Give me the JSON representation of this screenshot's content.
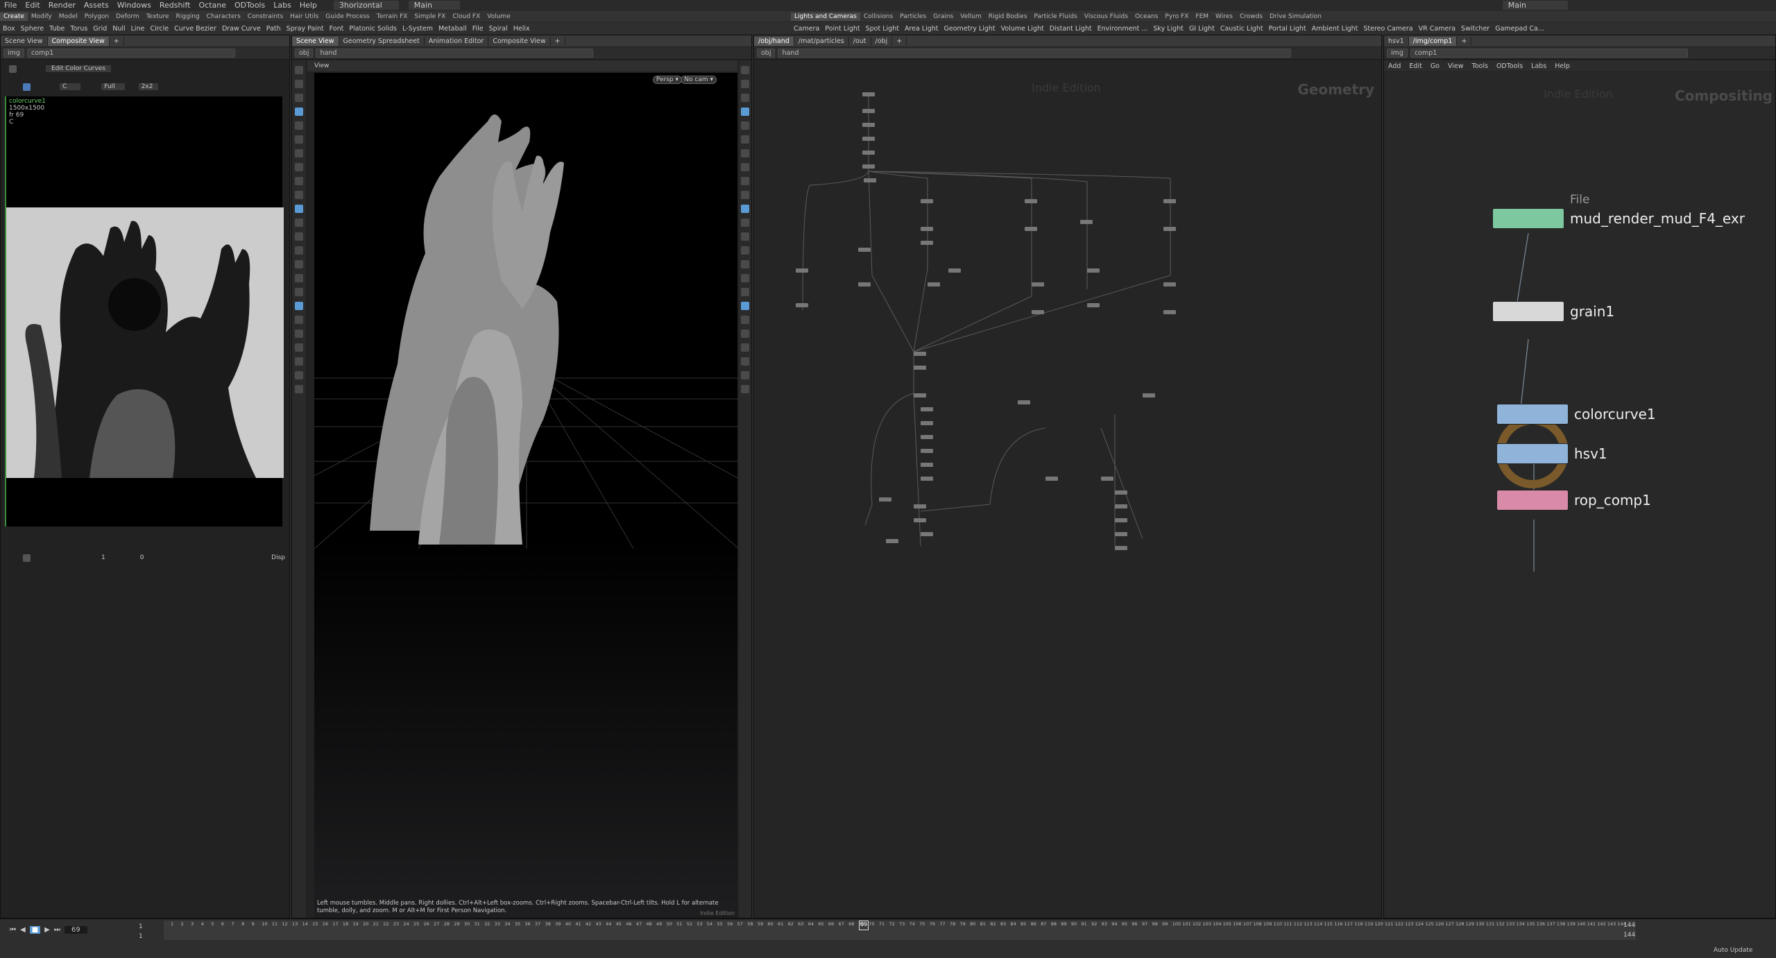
{
  "menu": {
    "items": [
      "File",
      "Edit",
      "Render",
      "Assets",
      "Windows",
      "Redshift",
      "Octane",
      "ODTools",
      "Labs",
      "Help"
    ],
    "desktop": "3horizontal",
    "context": "Main",
    "right_context": "Main"
  },
  "shelf_left": {
    "tabs": [
      "Create",
      "Modify",
      "Model",
      "Polygon",
      "Deform",
      "Texture",
      "Rigging",
      "Characters",
      "Constraints",
      "Hair Utils",
      "Guide Process",
      "Terrain FX",
      "Simple FX",
      "Cloud FX",
      "Volume"
    ],
    "tools": [
      "Box",
      "Sphere",
      "Tube",
      "Torus",
      "Grid",
      "Null",
      "Line",
      "Circle",
      "Curve Bezier",
      "Draw Curve",
      "Path",
      "Spray Paint",
      "Font",
      "Platonic Solids",
      "L-System",
      "Metaball",
      "File",
      "Spiral",
      "Helix"
    ]
  },
  "shelf_right": {
    "tabs": [
      "Lights and Cameras",
      "Collisions",
      "Particles",
      "Grains",
      "Vellum",
      "Rigid Bodies",
      "Particle Fluids",
      "Viscous Fluids",
      "Oceans",
      "Pyro FX",
      "FEM",
      "Wires",
      "Crowds",
      "Drive Simulation"
    ],
    "tools": [
      "Camera",
      "Point Light",
      "Spot Light",
      "Area Light",
      "Geometry Light",
      "Volume Light",
      "Distant Light",
      "Environment ...",
      "Sky Light",
      "GI Light",
      "Caustic Light",
      "Portal Light",
      "Ambient Light",
      "Stereo Camera",
      "VR Camera",
      "Switcher",
      "Gamepad Ca..."
    ]
  },
  "pane1": {
    "tabs": [
      "Scene View",
      "Composite View"
    ],
    "path": [
      "img",
      "comp1"
    ],
    "edit_button": "Edit Color Curves",
    "channel": "C",
    "res": "Full",
    "layout": "2x2",
    "info": [
      "colorcurve1",
      "1500x1500",
      "fr 69",
      "C"
    ],
    "bottom_frame": "1",
    "bottom_val": "0",
    "disp": "Disp"
  },
  "pane2": {
    "tabs": [
      "Scene View",
      "Geometry Spreadsheet",
      "Animation Editor",
      "Composite View"
    ],
    "path": [
      "obj",
      "hand"
    ],
    "view_label": "View",
    "persp": "Persp ▾",
    "cam": "No cam ▾",
    "hint": "Left mouse tumbles. Middle pans. Right dollies. Ctrl+Alt+Left box-zooms. Ctrl+Right zooms. Spacebar-Ctrl-Left tilts. Hold L for alternate tumble, dolly, and zoom.    M or Alt+M for First Person Navigation.",
    "edition": "Indie Edition"
  },
  "pane3": {
    "tabs": [
      "/obj/hand",
      "/mat/particles",
      "/out",
      "/obj"
    ],
    "path": [
      "obj",
      "hand"
    ],
    "watermark": "Indie Edition",
    "context": "Geometry"
  },
  "pane4": {
    "tabs": [
      "hsv1",
      "/img/comp1"
    ],
    "path": [
      "img",
      "comp1"
    ],
    "menu": [
      "Add",
      "Edit",
      "Go",
      "View",
      "Tools",
      "ODTools",
      "Labs",
      "Help"
    ],
    "watermark": "Indie Edition",
    "context": "Compositing",
    "nodes": [
      {
        "label": "mud_render_mud_F4_exr",
        "type": "File",
        "color": "#7ec8a0"
      },
      {
        "label": "grain1",
        "color": "#d8d8d8"
      },
      {
        "label": "colorcurve1",
        "color": "#8fb3d9"
      },
      {
        "label": "hsv1",
        "color": "#8fb3d9"
      },
      {
        "label": "rop_comp1",
        "color": "#d98aa8"
      }
    ]
  },
  "timeline": {
    "frame": "69",
    "start": "1",
    "start2": "1",
    "end": "144",
    "end2": "144",
    "ticks": [
      "1",
      "2",
      "3",
      "4",
      "5",
      "6",
      "7",
      "8",
      "9",
      "10",
      "11",
      "12",
      "13",
      "14",
      "15",
      "16",
      "17",
      "18",
      "19",
      "20",
      "21",
      "22",
      "23",
      "24",
      "25",
      "26",
      "27",
      "28",
      "29",
      "30",
      "31",
      "32",
      "33",
      "34",
      "35",
      "36",
      "37",
      "38",
      "39",
      "40",
      "41",
      "42",
      "43",
      "44",
      "45",
      "46",
      "47",
      "48",
      "49",
      "50",
      "51",
      "52",
      "53",
      "54",
      "55",
      "56",
      "57",
      "58",
      "59",
      "60",
      "61",
      "62",
      "63",
      "64",
      "65",
      "66",
      "67",
      "68",
      "69",
      "70",
      "71",
      "72",
      "73",
      "74",
      "75",
      "76",
      "77",
      "78",
      "79",
      "80",
      "81",
      "82",
      "83",
      "84",
      "85",
      "86",
      "87",
      "88",
      "89",
      "90",
      "91",
      "92",
      "93",
      "94",
      "95",
      "96",
      "97",
      "98",
      "99",
      "100",
      "101",
      "102",
      "103",
      "104",
      "105",
      "106",
      "107",
      "108",
      "109",
      "110",
      "111",
      "112",
      "113",
      "114",
      "115",
      "116",
      "117",
      "118",
      "119",
      "120",
      "121",
      "122",
      "123",
      "124",
      "125",
      "126",
      "127",
      "128",
      "129",
      "130",
      "131",
      "132",
      "133",
      "134",
      "135",
      "136",
      "137",
      "138",
      "139",
      "140",
      "141",
      "142",
      "143",
      "144"
    ],
    "auto_update": "Auto Update"
  },
  "colors": {
    "accent": "#5a9bd5",
    "green": "#46c846",
    "bg": "#2b2b2b"
  }
}
